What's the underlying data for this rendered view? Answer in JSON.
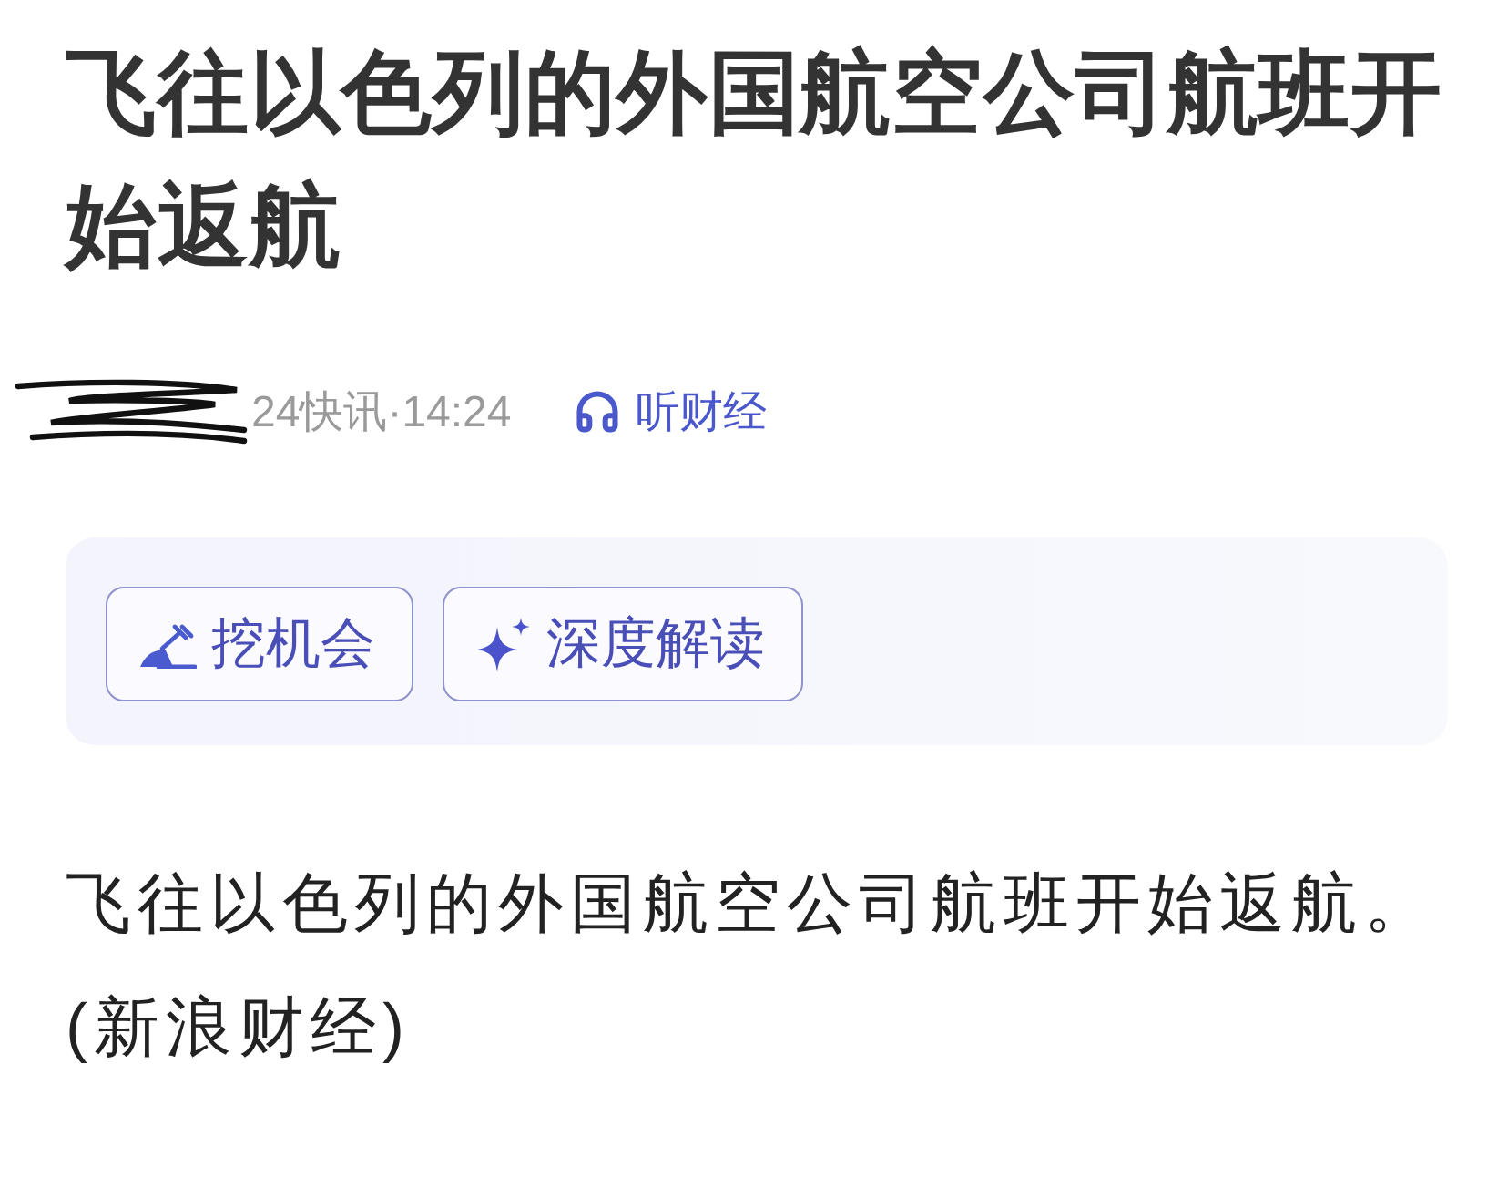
{
  "headline": "飞往以色列的外国航空公司航班开始返航",
  "meta": {
    "source": "24快讯·14:24",
    "listen_label": "听财经"
  },
  "actions": [
    {
      "kind": "dig",
      "label": "挖机会"
    },
    {
      "kind": "sparkle",
      "label": "深度解读"
    }
  ],
  "body": "飞往以色列的外国航空公司航班开始返航。(新浪财经)"
}
